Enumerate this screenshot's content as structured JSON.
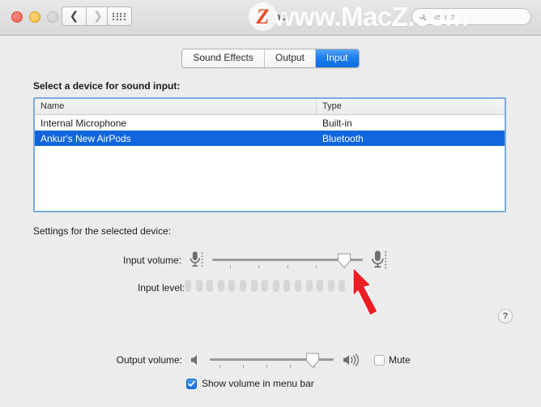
{
  "window": {
    "title": "Sound",
    "title_visible_fragment": "d",
    "traffic_lights": [
      "close",
      "minimize",
      "zoom"
    ],
    "nav_back_icon": "chevron-left-icon",
    "nav_forward_icon": "chevron-right-icon",
    "show_all_icon": "grid-icon"
  },
  "search": {
    "placeholder": "Search",
    "value": "",
    "icon": "search-icon"
  },
  "tabs": [
    {
      "label": "Sound Effects",
      "active": false
    },
    {
      "label": "Output",
      "active": false
    },
    {
      "label": "Input",
      "active": true
    }
  ],
  "device_section": {
    "heading": "Select a device for sound input:",
    "columns": [
      "Name",
      "Type"
    ],
    "rows": [
      {
        "name": "Internal Microphone",
        "type": "Built-in",
        "selected": false
      },
      {
        "name": "Ankur's New AirPods",
        "type": "Bluetooth",
        "selected": true
      }
    ]
  },
  "settings_section": {
    "heading": "Settings for the selected device:",
    "input_volume": {
      "label": "Input volume:",
      "value_percent": 88,
      "left_icon": "microphone-small-icon",
      "right_icon": "microphone-large-icon",
      "tick_count": 5
    },
    "input_level": {
      "label": "Input level:",
      "segment_count": 15,
      "active_segments": 0
    }
  },
  "output_section": {
    "label": "Output volume:",
    "value_percent": 83,
    "left_icon": "speaker-mute-icon",
    "right_icon": "speaker-loud-icon",
    "tick_count": 5,
    "mute": {
      "label": "Mute",
      "checked": false
    },
    "show_in_menu_bar": {
      "label": "Show volume in menu bar",
      "checked": true
    }
  },
  "help_button": {
    "label": "?"
  },
  "watermark": {
    "text": "www.MacZ.com",
    "logo_letter": "Z"
  },
  "annotation": {
    "type": "red-arrow",
    "points_to": "input-volume-slider-thumb"
  },
  "colors": {
    "accent_blue": "#1266dd",
    "tab_blue": "#1a7ced",
    "window_bg": "#ececec",
    "table_focus_ring": "#7aabde",
    "annotation_red": "#ee1c25"
  }
}
